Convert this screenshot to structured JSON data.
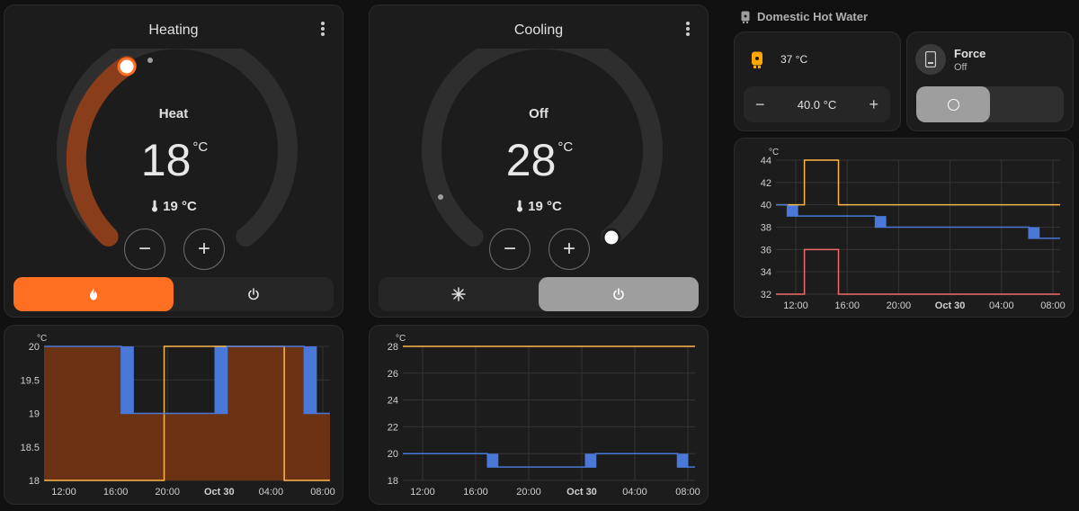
{
  "heating": {
    "title": "Heating",
    "mode": "Heat",
    "target": "18",
    "unit": "°C",
    "current": "19 °C",
    "minus": "−",
    "plus": "+",
    "accent": "#ff6f22",
    "arc_fraction": 0.55
  },
  "cooling": {
    "title": "Cooling",
    "mode": "Off",
    "target": "28",
    "unit": "°C",
    "current": "19 °C",
    "minus": "−",
    "plus": "+",
    "active_seg": "#9e9e9e"
  },
  "dhw": {
    "title": "Domestic Hot Water",
    "current": "37 °C",
    "target": "40.0 °C",
    "minus": "−",
    "plus": "+",
    "accent": "#ffa600",
    "force_label": "Force",
    "force_state": "Off"
  },
  "chart_data": [
    {
      "name": "heating-history",
      "type": "line",
      "unit": "°C",
      "ylim": [
        18,
        20
      ],
      "yticks": [
        "20",
        "19.5",
        "19",
        "18.5",
        "18"
      ],
      "xticks": [
        "12:00",
        "16:00",
        "20:00",
        "Oct 30",
        "04:00",
        "08:00"
      ],
      "series": [
        {
          "color": "#ffb74d",
          "values": [
            [
              0,
              18
            ],
            [
              0.42,
              18
            ],
            [
              0.42,
              20
            ],
            [
              0.84,
              20
            ],
            [
              0.84,
              18
            ],
            [
              1,
              18
            ]
          ]
        },
        {
          "color": "#4a78d8",
          "values": [
            [
              0,
              20
            ],
            [
              0.27,
              20
            ],
            [
              0.27,
              19
            ],
            [
              0.64,
              19
            ],
            [
              0.64,
              20
            ],
            [
              0.91,
              20
            ],
            [
              0.91,
              19
            ],
            [
              1,
              19
            ]
          ]
        }
      ]
    },
    {
      "name": "cooling-history",
      "type": "line",
      "unit": "°C",
      "ylim": [
        18,
        28
      ],
      "yticks": [
        "28",
        "26",
        "24",
        "22",
        "20",
        "18"
      ],
      "xticks": [
        "12:00",
        "16:00",
        "20:00",
        "Oct 30",
        "04:00",
        "08:00"
      ],
      "series": [
        {
          "color": "#ffb74d",
          "values": [
            [
              0,
              28
            ],
            [
              1,
              28
            ]
          ]
        },
        {
          "color": "#4a78d8",
          "values": [
            [
              0,
              20
            ],
            [
              0.29,
              20
            ],
            [
              0.29,
              19
            ],
            [
              0.66,
              19
            ],
            [
              0.66,
              20
            ],
            [
              0.94,
              20
            ],
            [
              0.94,
              19
            ],
            [
              1,
              19
            ]
          ]
        }
      ]
    },
    {
      "name": "dhw-history",
      "type": "line",
      "unit": "°C",
      "ylim": [
        32,
        44
      ],
      "yticks": [
        "44",
        "42",
        "40",
        "38",
        "36",
        "34",
        "32"
      ],
      "xticks": [
        "12:00",
        "16:00",
        "20:00",
        "Oct 30",
        "04:00",
        "08:00"
      ],
      "series": [
        {
          "color": "#ffb74d",
          "values": [
            [
              0,
              40
            ],
            [
              0.1,
              40
            ],
            [
              0.1,
              44
            ],
            [
              0.22,
              44
            ],
            [
              0.22,
              40
            ],
            [
              1,
              40
            ]
          ]
        },
        {
          "color": "#4a78d8",
          "values": [
            [
              0,
              40
            ],
            [
              0.04,
              40
            ],
            [
              0.04,
              39
            ],
            [
              0.35,
              39
            ],
            [
              0.35,
              38
            ],
            [
              0.89,
              38
            ],
            [
              0.89,
              37
            ],
            [
              1,
              37
            ]
          ]
        },
        {
          "color": "#f06a6a",
          "values": [
            [
              0,
              32
            ],
            [
              0.1,
              32
            ],
            [
              0.1,
              36
            ],
            [
              0.22,
              36
            ],
            [
              0.22,
              32
            ],
            [
              1,
              32
            ]
          ]
        }
      ]
    }
  ]
}
